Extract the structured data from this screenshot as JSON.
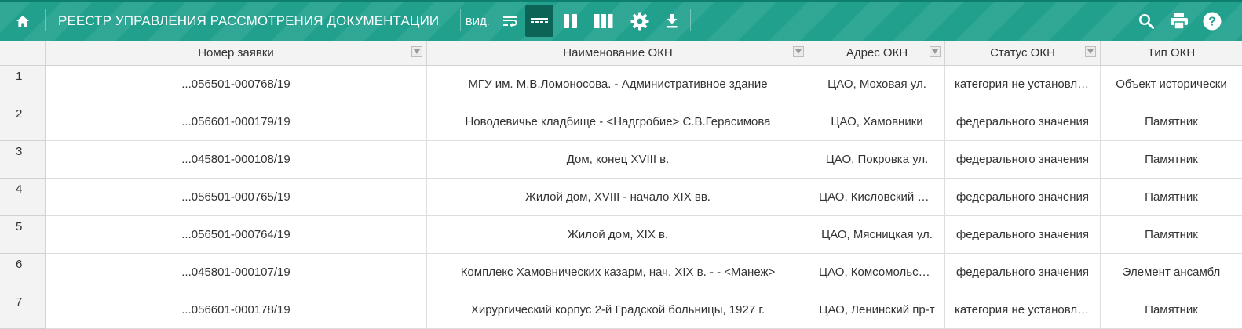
{
  "header": {
    "title": "РЕЕСТР УПРАВЛЕНИЯ РАССМОТРЕНИЯ ДОКУМЕНТАЦИИ",
    "view_label": "ВИД:"
  },
  "colors": {
    "toolbar": "#21a08e",
    "toolbar_active": "#0c6456",
    "header_bg": "#f3f3f3"
  },
  "icons": {
    "home": "home-icon",
    "view_modes": [
      "wrap-text-icon",
      "single-line-icon",
      "two-columns-icon",
      "three-columns-icon",
      "settings-icon",
      "download-icon"
    ],
    "actions": [
      "search-icon",
      "print-icon",
      "help-icon"
    ]
  },
  "table": {
    "columns": [
      "Номер заявки",
      "Наименование ОКН",
      "Адрес ОКН",
      "Статус ОКН",
      "Тип ОКН"
    ],
    "rows": [
      {
        "n": "1",
        "cells": [
          "...056501-000768/19",
          "МГУ им. М.В.Ломоносова. - Административное здание",
          "ЦАО, Моховая ул.",
          "категория не установлена",
          "Объект исторически"
        ]
      },
      {
        "n": "2",
        "cells": [
          "...056601-000179/19",
          "Новодевичье кладбище - <Надгробие> С.В.Герасимова",
          "ЦАО, Хамовники",
          "федерального значения",
          "Памятник"
        ]
      },
      {
        "n": "3",
        "cells": [
          "...045801-000108/19",
          "Дом, конец XVIII в.",
          "ЦАО, Покровка ул.",
          "федерального значения",
          "Памятник"
        ]
      },
      {
        "n": "4",
        "cells": [
          "...056501-000765/19",
          "Жилой дом, XVIII - начало XIX вв.",
          "ЦАО, Кисловский пер.",
          "федерального значения",
          "Памятник"
        ]
      },
      {
        "n": "5",
        "cells": [
          "...056501-000764/19",
          "Жилой дом, XIX в.",
          "ЦАО, Мясницкая ул.",
          "федерального значения",
          "Памятник"
        ]
      },
      {
        "n": "6",
        "cells": [
          "...045801-000107/19",
          "Комплекс Хамовнических казарм, нач. XIX в. - - <Манеж>",
          "ЦАО, Комсомольский пр-т",
          "федерального значения",
          "Элемент ансамбл"
        ]
      },
      {
        "n": "7",
        "cells": [
          "...056601-000178/19",
          "Хирургический корпус 2-й Градской больницы, 1927 г.",
          "ЦАО, Ленинский пр-т",
          "категория не установлена",
          "Памятник"
        ]
      }
    ]
  }
}
